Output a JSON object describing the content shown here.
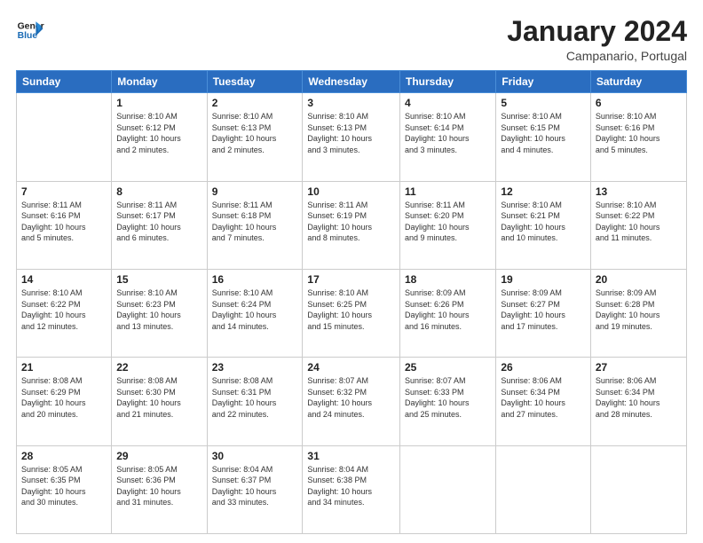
{
  "header": {
    "logo_line1": "General",
    "logo_line2": "Blue",
    "month": "January 2024",
    "location": "Campanario, Portugal"
  },
  "weekdays": [
    "Sunday",
    "Monday",
    "Tuesday",
    "Wednesday",
    "Thursday",
    "Friday",
    "Saturday"
  ],
  "weeks": [
    [
      {
        "day": "",
        "info": ""
      },
      {
        "day": "1",
        "info": "Sunrise: 8:10 AM\nSunset: 6:12 PM\nDaylight: 10 hours\nand 2 minutes."
      },
      {
        "day": "2",
        "info": "Sunrise: 8:10 AM\nSunset: 6:13 PM\nDaylight: 10 hours\nand 2 minutes."
      },
      {
        "day": "3",
        "info": "Sunrise: 8:10 AM\nSunset: 6:13 PM\nDaylight: 10 hours\nand 3 minutes."
      },
      {
        "day": "4",
        "info": "Sunrise: 8:10 AM\nSunset: 6:14 PM\nDaylight: 10 hours\nand 3 minutes."
      },
      {
        "day": "5",
        "info": "Sunrise: 8:10 AM\nSunset: 6:15 PM\nDaylight: 10 hours\nand 4 minutes."
      },
      {
        "day": "6",
        "info": "Sunrise: 8:10 AM\nSunset: 6:16 PM\nDaylight: 10 hours\nand 5 minutes."
      }
    ],
    [
      {
        "day": "7",
        "info": "Sunrise: 8:11 AM\nSunset: 6:16 PM\nDaylight: 10 hours\nand 5 minutes."
      },
      {
        "day": "8",
        "info": "Sunrise: 8:11 AM\nSunset: 6:17 PM\nDaylight: 10 hours\nand 6 minutes."
      },
      {
        "day": "9",
        "info": "Sunrise: 8:11 AM\nSunset: 6:18 PM\nDaylight: 10 hours\nand 7 minutes."
      },
      {
        "day": "10",
        "info": "Sunrise: 8:11 AM\nSunset: 6:19 PM\nDaylight: 10 hours\nand 8 minutes."
      },
      {
        "day": "11",
        "info": "Sunrise: 8:11 AM\nSunset: 6:20 PM\nDaylight: 10 hours\nand 9 minutes."
      },
      {
        "day": "12",
        "info": "Sunrise: 8:10 AM\nSunset: 6:21 PM\nDaylight: 10 hours\nand 10 minutes."
      },
      {
        "day": "13",
        "info": "Sunrise: 8:10 AM\nSunset: 6:22 PM\nDaylight: 10 hours\nand 11 minutes."
      }
    ],
    [
      {
        "day": "14",
        "info": "Sunrise: 8:10 AM\nSunset: 6:22 PM\nDaylight: 10 hours\nand 12 minutes."
      },
      {
        "day": "15",
        "info": "Sunrise: 8:10 AM\nSunset: 6:23 PM\nDaylight: 10 hours\nand 13 minutes."
      },
      {
        "day": "16",
        "info": "Sunrise: 8:10 AM\nSunset: 6:24 PM\nDaylight: 10 hours\nand 14 minutes."
      },
      {
        "day": "17",
        "info": "Sunrise: 8:10 AM\nSunset: 6:25 PM\nDaylight: 10 hours\nand 15 minutes."
      },
      {
        "day": "18",
        "info": "Sunrise: 8:09 AM\nSunset: 6:26 PM\nDaylight: 10 hours\nand 16 minutes."
      },
      {
        "day": "19",
        "info": "Sunrise: 8:09 AM\nSunset: 6:27 PM\nDaylight: 10 hours\nand 17 minutes."
      },
      {
        "day": "20",
        "info": "Sunrise: 8:09 AM\nSunset: 6:28 PM\nDaylight: 10 hours\nand 19 minutes."
      }
    ],
    [
      {
        "day": "21",
        "info": "Sunrise: 8:08 AM\nSunset: 6:29 PM\nDaylight: 10 hours\nand 20 minutes."
      },
      {
        "day": "22",
        "info": "Sunrise: 8:08 AM\nSunset: 6:30 PM\nDaylight: 10 hours\nand 21 minutes."
      },
      {
        "day": "23",
        "info": "Sunrise: 8:08 AM\nSunset: 6:31 PM\nDaylight: 10 hours\nand 22 minutes."
      },
      {
        "day": "24",
        "info": "Sunrise: 8:07 AM\nSunset: 6:32 PM\nDaylight: 10 hours\nand 24 minutes."
      },
      {
        "day": "25",
        "info": "Sunrise: 8:07 AM\nSunset: 6:33 PM\nDaylight: 10 hours\nand 25 minutes."
      },
      {
        "day": "26",
        "info": "Sunrise: 8:06 AM\nSunset: 6:34 PM\nDaylight: 10 hours\nand 27 minutes."
      },
      {
        "day": "27",
        "info": "Sunrise: 8:06 AM\nSunset: 6:34 PM\nDaylight: 10 hours\nand 28 minutes."
      }
    ],
    [
      {
        "day": "28",
        "info": "Sunrise: 8:05 AM\nSunset: 6:35 PM\nDaylight: 10 hours\nand 30 minutes."
      },
      {
        "day": "29",
        "info": "Sunrise: 8:05 AM\nSunset: 6:36 PM\nDaylight: 10 hours\nand 31 minutes."
      },
      {
        "day": "30",
        "info": "Sunrise: 8:04 AM\nSunset: 6:37 PM\nDaylight: 10 hours\nand 33 minutes."
      },
      {
        "day": "31",
        "info": "Sunrise: 8:04 AM\nSunset: 6:38 PM\nDaylight: 10 hours\nand 34 minutes."
      },
      {
        "day": "",
        "info": ""
      },
      {
        "day": "",
        "info": ""
      },
      {
        "day": "",
        "info": ""
      }
    ]
  ]
}
